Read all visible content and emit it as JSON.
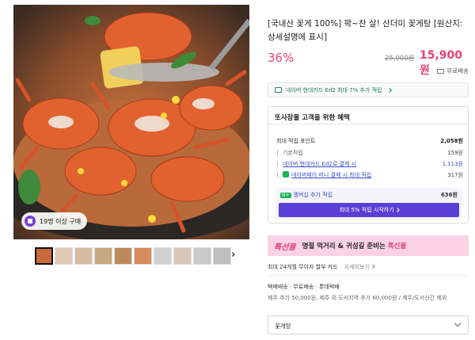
{
  "product": {
    "title": "[국내산 꽃게 100%] 꽉~찬 살! 산더미 꽃게탕 [원산지: 상세설명에 표시]",
    "discount": "36%",
    "original_price": "25,000원",
    "price": "15,900원",
    "shipping_note": "무료배송",
    "image_badge": "19명 이상 구매"
  },
  "card_banner": "네이버 현대카드 Ed2 최대 7% 추가 적립",
  "benefit": {
    "heading": "또사장몰 고객을 위한 혜택",
    "rows": [
      {
        "label": "최대 적립 포인트",
        "value": "2,058원"
      },
      {
        "label": "기본적립",
        "value": "159원"
      },
      {
        "label": "네이버 현대카드 Ed2로 결제 시",
        "value": "1,113원"
      },
      {
        "label": "네이버페이 머니 결제 시 최대 적립",
        "value": "317원"
      }
    ],
    "membership_label": "멤버십 추가 적립",
    "membership_value": "636원",
    "membership_button": "최대 5% 적립 시작하기"
  },
  "ad": {
    "logo": "특선몰",
    "text_before": "명절 먹거리 & 귀성길 준비는 ",
    "text_highlight": "특선몰"
  },
  "installment": {
    "label": "최대 24개월 무이자 할부 카드",
    "more": "자세히보기"
  },
  "shipping": {
    "line1": "택배배송 · 무료배송 · 롯데택배",
    "line2": "제주 추가 50,000원, 제주 외 도서지역 추가 60,000원 / 제주/도서산간 제외"
  },
  "option_select": {
    "value": "꽃게탕"
  },
  "colors": {
    "accent": "#ea3f71",
    "brand_purple": "#5a3fd6",
    "naver_green": "#1fb35a"
  }
}
